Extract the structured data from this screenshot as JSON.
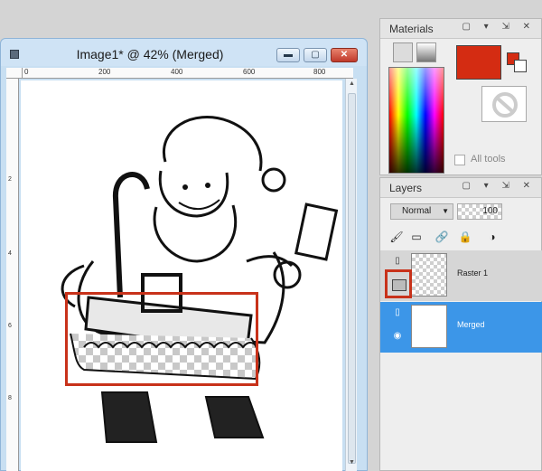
{
  "document": {
    "title": "Image1* @  42% (Merged)",
    "ruler_labels": [
      "0",
      "200",
      "400",
      "600",
      "800"
    ],
    "vruler_labels": [
      "2",
      "4",
      "6",
      "8"
    ],
    "window_buttons": {
      "minimize": "▬",
      "maximize": "▢",
      "close": "✕"
    }
  },
  "materials": {
    "title": "Materials",
    "controls": "▢ ▾ ⇲ ✕",
    "all_tools_label": "All tools",
    "foreground_color": "#d42c12",
    "background_color": "#ffffff"
  },
  "layers": {
    "title": "Layers",
    "controls": "▢ ▾ ⇲ ✕",
    "blend_mode": "Normal",
    "opacity": "100",
    "items": [
      {
        "name": "Raster 1",
        "selected": false
      },
      {
        "name": "Merged",
        "selected": true
      }
    ]
  },
  "colors": {
    "highlight": "#c8321a",
    "selection": "#3c96e8"
  }
}
